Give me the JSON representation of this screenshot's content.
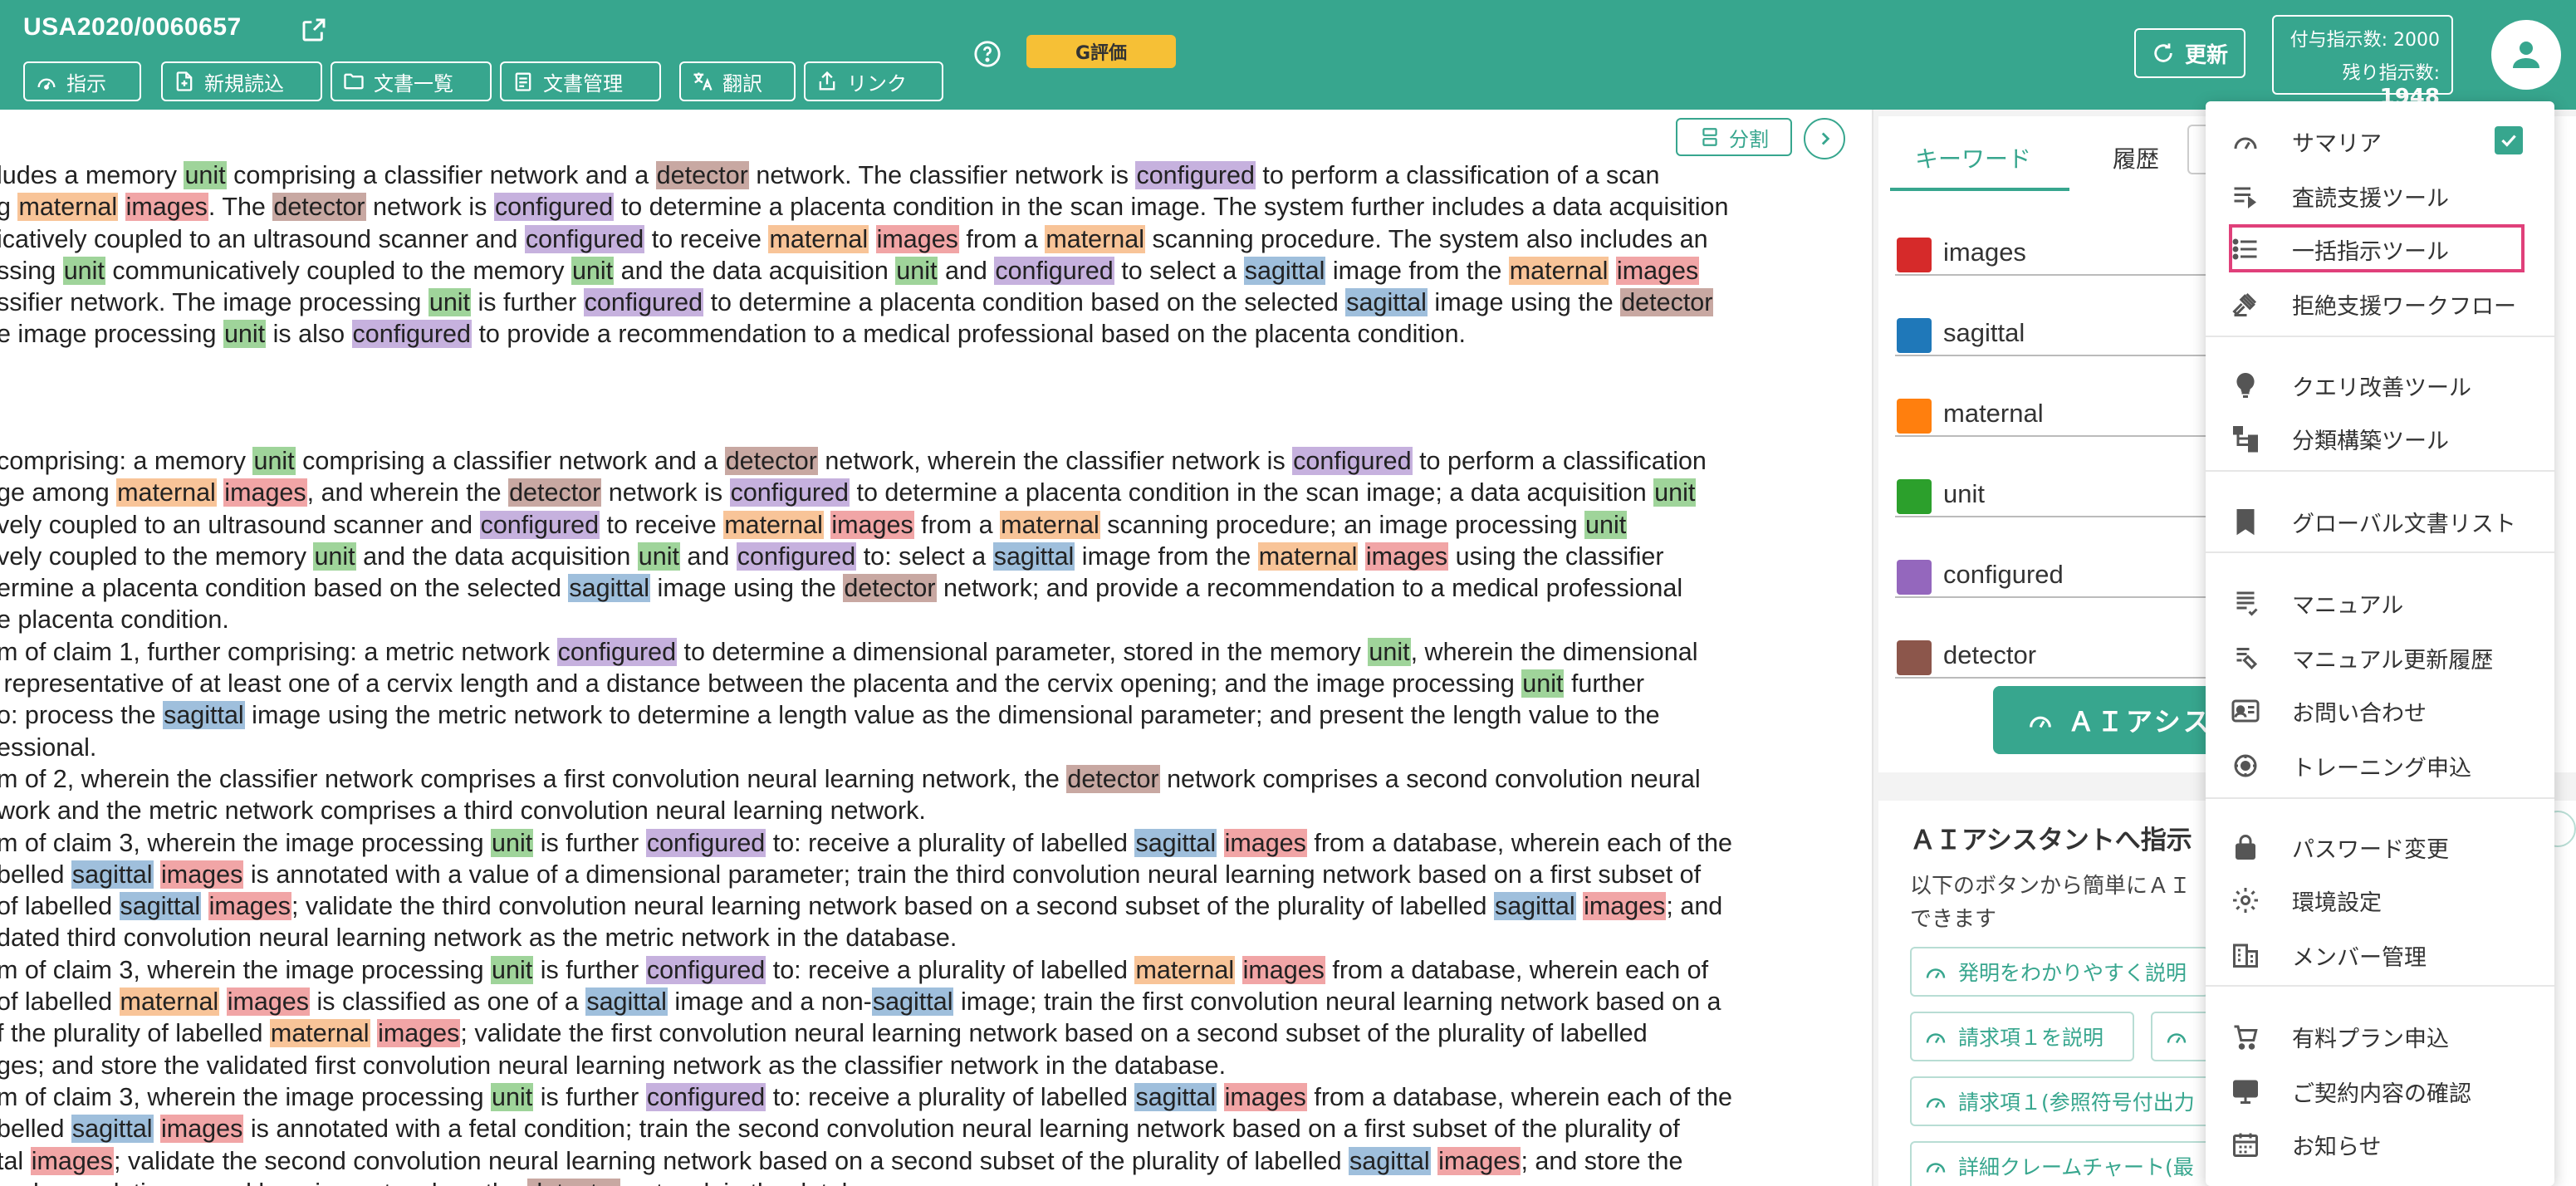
{
  "header": {
    "doc_id": "USA2020/0060657",
    "toolbar": [
      {
        "id": "instruct",
        "label": "指示",
        "icon": "gauge-icon"
      },
      {
        "id": "new-read",
        "label": "新規読込",
        "icon": "file-plus-icon"
      },
      {
        "id": "doc-list",
        "label": "文書一覧",
        "icon": "folder-icon"
      },
      {
        "id": "doc-manage",
        "label": "文書管理",
        "icon": "clipboard-icon"
      },
      {
        "id": "translate",
        "label": "翻訳",
        "icon": "translate-icon"
      },
      {
        "id": "link",
        "label": "リンク",
        "icon": "share-icon"
      }
    ],
    "grade_label": "G評価",
    "update_label": "更新",
    "granted_label": "付与指示数: 2000",
    "remaining_label": "残り指示数:",
    "remaining_value": "1948"
  },
  "doc": {
    "split_label": "分割",
    "paragraphs": [
      {
        "lines": [
          "ludes a memory [unit] comprising a classifier network and a [detector] network. The classifier network is [configured] to perform a classification of a scan",
          "g [maternal] [images]. The [detector] network is [configured] to determine a placenta condition in the scan image. The system further includes a data acquisition",
          "icatively coupled to an ultrasound scanner and [configured] to receive [maternal] [images] from a [maternal] scanning procedure. The system also includes an",
          "ssing [unit] communicatively coupled to the memory [unit] and the data acquisition [unit] and [configured] to select a [sagittal] image from the [maternal] [images]",
          "ssifier network. The image processing [unit] is further [configured] to determine a placenta condition based on the selected [sagittal] image using the [detector]",
          "e image processing [unit] is also [configured] to provide a recommendation to a medical professional based on the placenta condition."
        ]
      },
      {
        "lines": [
          "comprising: a memory [unit] comprising a classifier network and a [detector] network, wherein the classifier network is [configured] to perform a classification",
          "ge among [maternal] [images], and wherein the [detector] network is [configured] to determine a placenta condition in the scan image; a data acquisition [unit]",
          "vely coupled to an ultrasound scanner and [configured] to receive [maternal] [images] from a [maternal] scanning procedure; an image processing [unit]",
          "vely coupled to the memory [unit] and the data acquisition [unit] and [configured] to: select a [sagittal] image from the [maternal] [images] using the classifier",
          "ermine a placenta condition based on the selected [sagittal] image using the [detector] network; and provide a recommendation to a medical professional",
          "e placenta condition.",
          "m of claim 1, further comprising: a metric network [configured] to determine a dimensional parameter, stored in the memory [unit], wherein the dimensional",
          " representative of at least one of a cervix length and a distance between the placenta and the cervix opening; and the image processing [unit] further",
          "o: process the [sagittal] image using the metric network to determine a length value as the dimensional parameter; and present the length value to the",
          "essional.",
          "m of 2, wherein the classifier network comprises a first convolution neural learning network, the [detector] network comprises a second convolution neural",
          "work and the metric network comprises a third convolution neural learning network.",
          "m of claim 3, wherein the image processing [unit] is further [configured] to: receive a plurality of labelled [sagittal] [images] from a database, wherein each of the",
          "belled [sagittal] [images] is annotated with a value of a dimensional parameter; train the third convolution neural learning network based on a first subset of",
          "of labelled [sagittal] [images]; validate the third convolution neural learning network based on a second subset of the plurality of labelled [sagittal] [images]; and",
          "dated third convolution neural learning network as the metric network in the database.",
          "m of claim 3, wherein the image processing [unit] is further [configured] to: receive a plurality of labelled [maternal] [images] from a database, wherein each of",
          "of labelled [maternal] [images] is classified as one of a [sagittal] image and a non-[sagittal] image; train the first convolution neural learning network based on a",
          "f the plurality of labelled [maternal] [images]; validate the first convolution neural learning network based on a second subset of the plurality of labelled",
          "ges; and store the validated first convolution neural learning network as the classifier network in the database.",
          "m of claim 3, wherein the image processing [unit] is further [configured] to: receive a plurality of labelled [sagittal] [images] from a database, wherein each of the",
          "belled [sagittal] [images] is annotated with a fetal condition; train the second convolution neural learning network based on a first subset of the plurality of",
          "tal [images]; validate the second convolution neural learning network based on a second subset of the plurality of labelled [sagittal] [images]; and store the",
          "ond convolution neural learning network as the [detector] network in the database."
        ]
      }
    ]
  },
  "keywords_panel": {
    "tab_keyword": "キーワード",
    "tab_history": "履歴",
    "keywords": [
      {
        "word": "images",
        "color": "#d62a2a"
      },
      {
        "word": "sagittal",
        "color": "#1f78b9"
      },
      {
        "word": "maternal",
        "color": "#ff7f0e"
      },
      {
        "word": "unit",
        "color": "#2ca02c"
      },
      {
        "word": "configured",
        "color": "#9467bd"
      },
      {
        "word": "detector",
        "color": "#8c564b"
      }
    ],
    "ai_button_label": "ＡＩアシス"
  },
  "ai_panel": {
    "title": "ＡＩアシスタントへ指示",
    "desc_line1": "以下のボタンから簡単にＡＩ",
    "desc_line2": "できます",
    "suggestions": [
      "発明をわかりやすく説明",
      "請求項１を説明",
      "",
      "請求項１(参照符号付出力",
      "詳細クレームチャート(最"
    ]
  },
  "menu": {
    "items": [
      {
        "label": "サマリア",
        "icon": "gauge-icon",
        "checked": true
      },
      {
        "label": "査読支援ツール",
        "icon": "list-arrow-icon"
      },
      {
        "label": "一括指示ツール",
        "icon": "list-icon",
        "highlighted": true
      },
      {
        "label": "拒絶支援ワークフロー",
        "icon": "gavel-icon"
      },
      {
        "label": "クエリ改善ツール",
        "icon": "lightbulb-icon"
      },
      {
        "label": "分類構築ツール",
        "icon": "hierarchy-icon"
      },
      {
        "label": "グローバル文書リスト",
        "icon": "bookmark-icon"
      },
      {
        "label": "マニュアル",
        "icon": "manual-icon"
      },
      {
        "label": "マニュアル更新履歴",
        "icon": "manual-history-icon"
      },
      {
        "label": "お問い合わせ",
        "icon": "contact-card-icon"
      },
      {
        "label": "トレーニング申込",
        "icon": "training-icon"
      },
      {
        "label": "パスワード変更",
        "icon": "lock-icon"
      },
      {
        "label": "環境設定",
        "icon": "gear-icon"
      },
      {
        "label": "メンバー管理",
        "icon": "members-icon"
      },
      {
        "label": "有料プラン申込",
        "icon": "cart-icon"
      },
      {
        "label": "ご契約内容の確認",
        "icon": "monitor-icon"
      },
      {
        "label": "お知らせ",
        "icon": "calendar-icon"
      }
    ]
  }
}
